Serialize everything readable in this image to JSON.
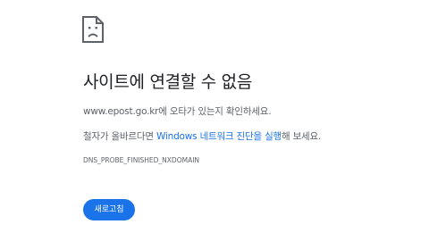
{
  "error_icon": "sad-document-icon",
  "title": "사이트에 연결할 수 없음",
  "suggestion1": {
    "domain": "www.epost.go.kr",
    "suffix": "에 오타가 있는지 확인하세요."
  },
  "suggestion2": {
    "prefix": "철자가 올바르다면 ",
    "link": "Windows 네트워크 진단을 실행",
    "suffix": "해 보세요."
  },
  "error_code": "DNS_PROBE_FINISHED_NXDOMAIN",
  "reload_button": "새로고침",
  "colors": {
    "accent": "#1a73e8",
    "text": "#202124",
    "secondary_text": "#5f6368"
  }
}
